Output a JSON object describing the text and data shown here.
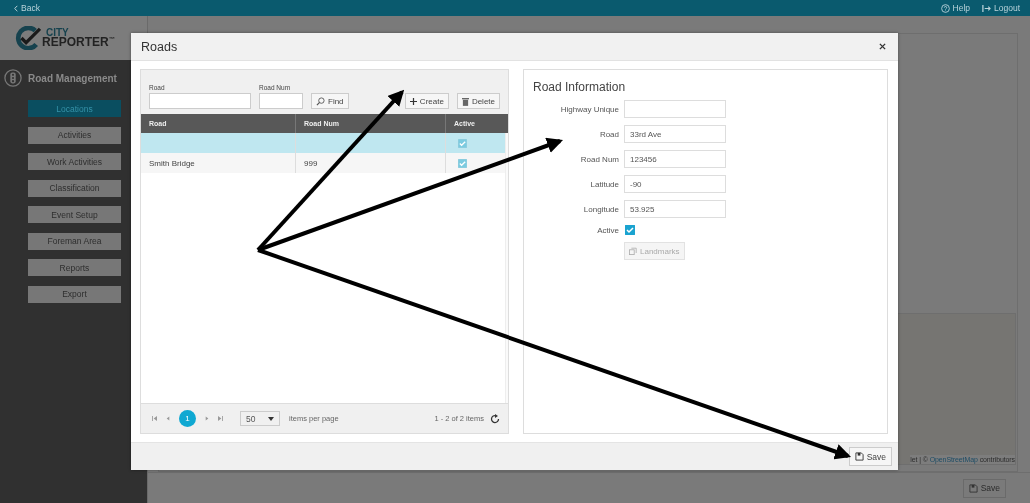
{
  "top_bar": {
    "back": "Back",
    "help": "Help",
    "logout": "Logout"
  },
  "sidebar": {
    "logo": {
      "line1": "CITY",
      "line2": "REPORTER",
      "mark": "™"
    },
    "section": "Road Management",
    "items": [
      {
        "label": "Locations",
        "selected": true
      },
      {
        "label": "Activities",
        "selected": false
      },
      {
        "label": "Work Activities",
        "selected": false
      },
      {
        "label": "Classification",
        "selected": false
      },
      {
        "label": "Event Setup",
        "selected": false
      },
      {
        "label": "Foreman Area",
        "selected": false
      },
      {
        "label": "Reports",
        "selected": false
      },
      {
        "label": "Export",
        "selected": false
      }
    ]
  },
  "background": {
    "map_attribution": {
      "prefix": "let | ©",
      "link": "OpenStreetMap",
      "suffix": "contributors"
    },
    "save": "Save"
  },
  "dialog": {
    "title": "Roads",
    "filters": [
      {
        "label": "Road"
      },
      {
        "label": "Road Num"
      }
    ],
    "find": "Find",
    "create": "Create",
    "delete": "Delete",
    "grid": {
      "columns": [
        "Road",
        "Road Num",
        "Active"
      ],
      "rows": [
        {
          "active": true,
          "selected": true
        },
        {
          "road": "Smith Bridge",
          "road_num": "999",
          "active": true,
          "selected": false
        }
      ]
    },
    "pager": {
      "page": "1",
      "page_size": "50",
      "per_page": "items per page",
      "summary": "1 - 2 of 2 items"
    },
    "info": {
      "title": "Road Information",
      "fields": [
        {
          "label": "Highway Unique"
        },
        {
          "label": "Road",
          "value": "33rd Ave"
        },
        {
          "label": "Road Num",
          "value": "123456"
        },
        {
          "label": "Latitude",
          "value": "-90"
        },
        {
          "label": "Longitude",
          "value": "53.925"
        }
      ],
      "active": {
        "label": "Active",
        "checked": true
      },
      "landmarks": "Landmarks"
    },
    "save": "Save"
  }
}
